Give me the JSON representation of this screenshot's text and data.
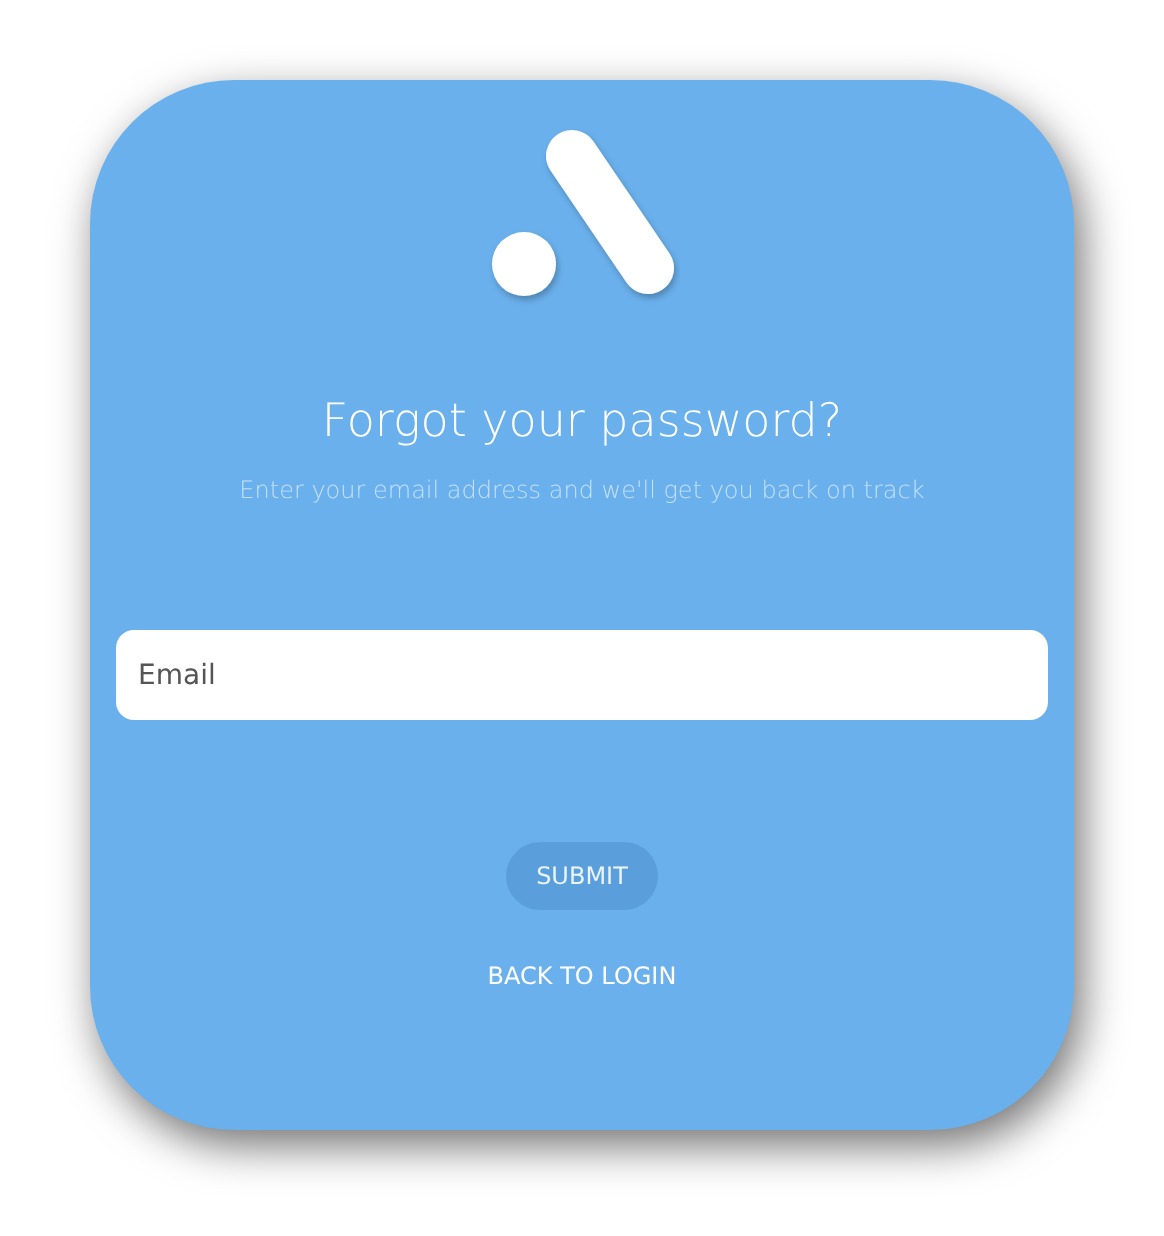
{
  "title": "Forgot your password?",
  "subtitle": "Enter your email address and we'll get you back on track",
  "email_field": {
    "placeholder": "Email"
  },
  "submit_button": "SUBMIT",
  "back_link": "BACK TO LOGIN"
}
